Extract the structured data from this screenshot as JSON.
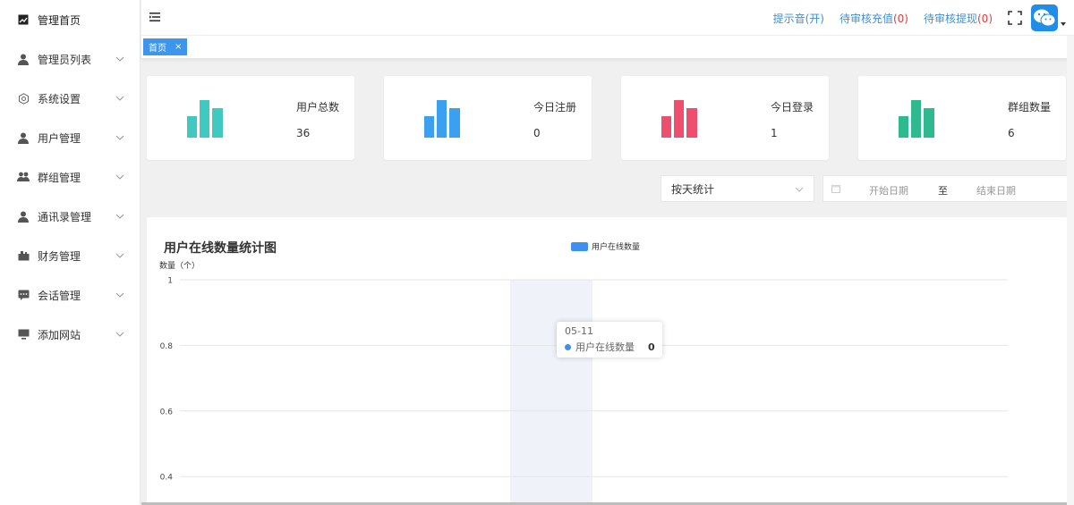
{
  "sidebar": {
    "items": [
      {
        "label": "管理首页",
        "icon": "chart-line-icon",
        "active": true,
        "has_children": false
      },
      {
        "label": "管理员列表",
        "icon": "user-icon",
        "has_children": true
      },
      {
        "label": "系统设置",
        "icon": "gear-icon",
        "has_children": true
      },
      {
        "label": "用户管理",
        "icon": "user-icon",
        "has_children": true
      },
      {
        "label": "群组管理",
        "icon": "group-icon",
        "has_children": true
      },
      {
        "label": "通讯录管理",
        "icon": "user-icon",
        "has_children": true
      },
      {
        "label": "财务管理",
        "icon": "finance-icon",
        "has_children": true
      },
      {
        "label": "会话管理",
        "icon": "chat-icon",
        "has_children": true
      },
      {
        "label": "添加网站",
        "icon": "monitor-icon",
        "has_children": true
      }
    ]
  },
  "header": {
    "sound": "提示音(开)",
    "recharge_label": "待审核充值",
    "recharge_count": "(0)",
    "withdraw_label": "待审核提现",
    "withdraw_count": "(0)",
    "avatar_icon": "wechat-icon"
  },
  "tabs": [
    {
      "label": "首页",
      "close": "×"
    }
  ],
  "stats": [
    {
      "title": "用户总数",
      "value": "36",
      "color": "#3fc9c0"
    },
    {
      "title": "今日注册",
      "value": "0",
      "color": "#3aa0ef"
    },
    {
      "title": "今日登录",
      "value": "1",
      "color": "#ef4f6e"
    },
    {
      "title": "群组数量",
      "value": "6",
      "color": "#2fb98f"
    }
  ],
  "filters": {
    "mode": "按天统计",
    "start_placeholder": "开始日期",
    "separator": "至",
    "end_placeholder": "结束日期"
  },
  "chart_title": "用户在线数量统计图",
  "chart_data": {
    "type": "bar",
    "title": "用户在线数量统计图",
    "ylabel": "数量（个）",
    "ylim": [
      0,
      1
    ],
    "yticks": [
      "1",
      "0.8",
      "0.6",
      "0.4"
    ],
    "grid": true,
    "legend": "top-center",
    "series": [
      {
        "name": "用户在线数量",
        "color": "#3d8ff0",
        "values": [
          0
        ]
      }
    ],
    "categories": [
      "05-11"
    ]
  },
  "tooltip": {
    "date": "05-11",
    "series": "用户在线数量",
    "value": "0"
  }
}
